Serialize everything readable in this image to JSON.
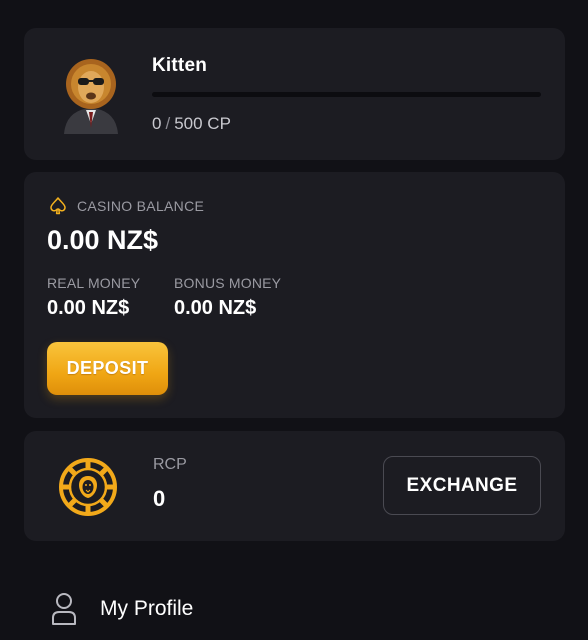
{
  "level": {
    "name": "Kitten",
    "cp_current": "0",
    "cp_separator": "/",
    "cp_target": "500 CP",
    "progress_fraction": 0,
    "avatar_icon": "lion-avatar-icon"
  },
  "balance": {
    "header_label": "CASINO BALANCE",
    "header_icon": "spade-icon",
    "total": "0.00 NZ$",
    "real_money_label": "REAL MONEY",
    "real_money_value": "0.00 NZ$",
    "bonus_money_label": "BONUS MONEY",
    "bonus_money_value": "0.00 NZ$",
    "deposit_label": "DEPOSIT"
  },
  "rcp": {
    "icon": "casino-chip-icon",
    "label": "RCP",
    "value": "0",
    "exchange_label": "EXCHANGE"
  },
  "menu": {
    "items": [
      {
        "label": "My Profile",
        "icon": "user-icon"
      }
    ]
  },
  "colors": {
    "background": "#111116",
    "card": "#1c1c22",
    "accent": "#f2b01e",
    "muted_text": "#9a9aa2"
  }
}
